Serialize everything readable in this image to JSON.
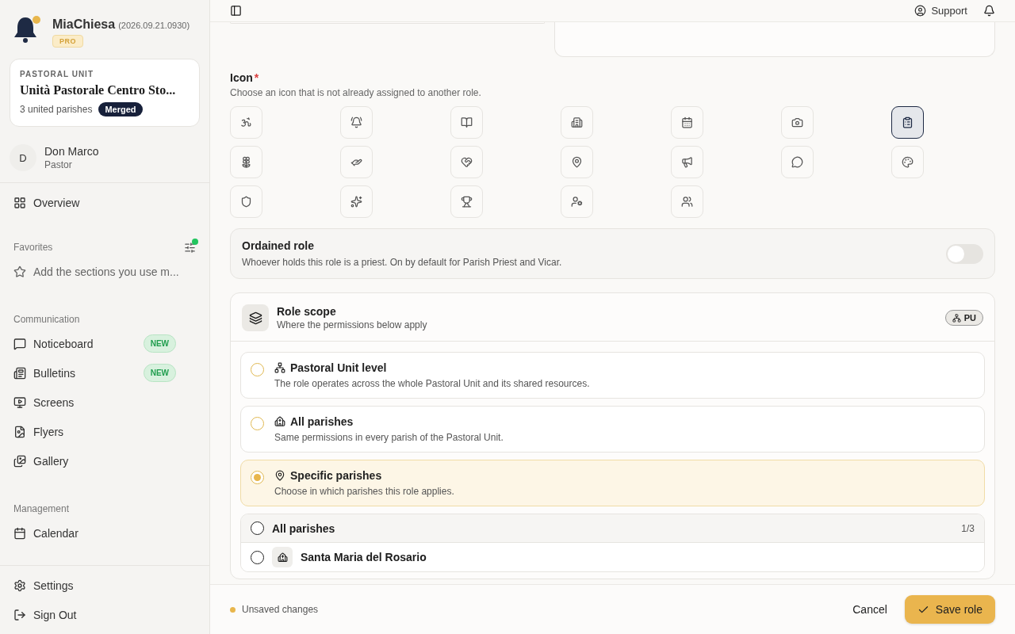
{
  "brand": {
    "name": "MiaChiesa",
    "version": "(2026.09.21.0930)",
    "plan": "PRO"
  },
  "unit": {
    "label": "PASTORAL UNIT",
    "name": "Unità Pastorale Centro Sto...",
    "count": "3 united parishes",
    "badge": "Merged"
  },
  "user": {
    "initial": "D",
    "name": "Don Marco",
    "role": "Pastor"
  },
  "nav_top": [
    {
      "label": "Overview",
      "selected": false
    }
  ],
  "favorites": {
    "title": "Favorites",
    "hint": "Add the sections you use m...",
    "has_update": true
  },
  "sections": [
    {
      "title": "Communication",
      "items": [
        {
          "label": "Noticeboard",
          "badge": "NEW"
        },
        {
          "label": "Bulletins",
          "badge": "NEW"
        },
        {
          "label": "Screens"
        },
        {
          "label": "Flyers"
        },
        {
          "label": "Gallery"
        }
      ]
    },
    {
      "title": "Management",
      "items": [
        {
          "label": "Calendar"
        }
      ]
    }
  ],
  "nav_bottom": [
    {
      "label": "Settings"
    },
    {
      "label": "Sign Out"
    }
  ],
  "header": {
    "support": "Support"
  },
  "icon_field": {
    "label": "Icon",
    "required_mark": "*",
    "hint": "Choose an icon that is not already assigned to another role.",
    "icons": [
      {
        "selected": false
      },
      {
        "selected": false
      },
      {
        "selected": false
      },
      {
        "selected": false
      },
      {
        "selected": false
      },
      {
        "selected": false
      },
      {
        "selected": true
      },
      {
        "selected": false
      },
      {
        "selected": false
      },
      {
        "selected": false
      },
      {
        "selected": false
      },
      {
        "selected": false
      },
      {
        "selected": false
      },
      {
        "selected": false
      },
      {
        "selected": false
      },
      {
        "selected": false
      },
      {
        "selected": false
      },
      {
        "selected": false
      },
      {
        "selected": false
      }
    ]
  },
  "ordained": {
    "title": "Ordained role",
    "description": "Whoever holds this role is a priest. On by default for Parish Priest and Vicar.",
    "on": false
  },
  "scope": {
    "title": "Role scope",
    "subtitle": "Where the permissions below apply",
    "badge": "PU",
    "options": [
      {
        "title": "Pastoral Unit level",
        "description": "The role operates across the whole Pastoral Unit and its shared resources.",
        "selected": false
      },
      {
        "title": "All parishes",
        "description": "Same permissions in every parish of the Pastoral Unit.",
        "selected": false
      },
      {
        "title": "Specific parishes",
        "description": "Choose in which parishes this role applies.",
        "selected": true
      }
    ],
    "parishes": {
      "all_label": "All parishes",
      "count": "1/3",
      "all_checked": false,
      "items": [
        {
          "name": "Santa Maria del Rosario",
          "checked": false
        }
      ]
    }
  },
  "footer": {
    "status": "Unsaved changes",
    "cancel": "Cancel",
    "save": "Save role"
  }
}
